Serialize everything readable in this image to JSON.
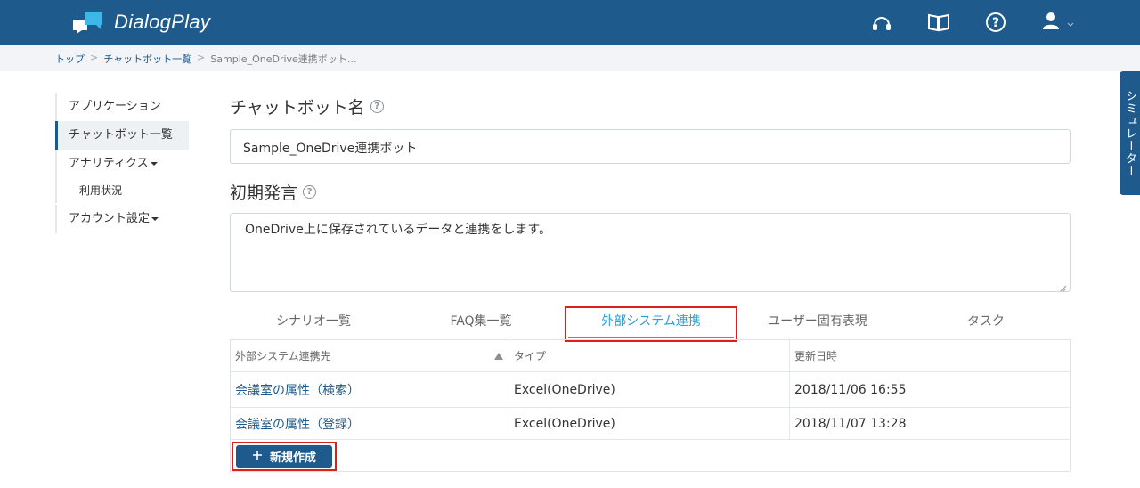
{
  "header": {
    "app_name": "DialogPlay",
    "icons": [
      "support-headset-icon",
      "manual-book-icon",
      "help-icon",
      "user-icon",
      "chevron-down-icon"
    ]
  },
  "breadcrumb": {
    "items": [
      "トップ",
      "チャットボット一覧",
      "Sample_OneDrive連携ボット…"
    ]
  },
  "sidebar": {
    "items": [
      {
        "label": "アプリケーション"
      },
      {
        "label": "チャットボット一覧"
      },
      {
        "label": "アナリティクス"
      },
      {
        "label": "利用状況"
      },
      {
        "label": "アカウント設定"
      }
    ]
  },
  "form": {
    "name_title": "チャットボット名",
    "name_value": "Sample_OneDrive連携ボット",
    "greeting_title": "初期発言",
    "greeting_value": "OneDrive上に保存されているデータと連携をします。"
  },
  "tabs": [
    {
      "label": "シナリオ一覧"
    },
    {
      "label": "FAQ集一覧"
    },
    {
      "label": "外部システム連携"
    },
    {
      "label": "ユーザー固有表現"
    },
    {
      "label": "タスク"
    }
  ],
  "active_tab": "外部システム連携",
  "table": {
    "columns": [
      "外部システム連携先",
      "タイプ",
      "更新日時"
    ],
    "rows": [
      {
        "name": "会議室の属性（検索）",
        "type": "Excel(OneDrive)",
        "updated": "2018/11/06 16:55"
      },
      {
        "name": "会議室の属性（登録）",
        "type": "Excel(OneDrive)",
        "updated": "2018/11/07 13:28"
      }
    ]
  },
  "new_button": {
    "label": "新規作成"
  },
  "simulator_tab": {
    "label": "シミュレーター"
  },
  "colors": {
    "brand": "#1f5a8c",
    "accent": "#2a9fd6",
    "highlight": "#d9211e"
  }
}
